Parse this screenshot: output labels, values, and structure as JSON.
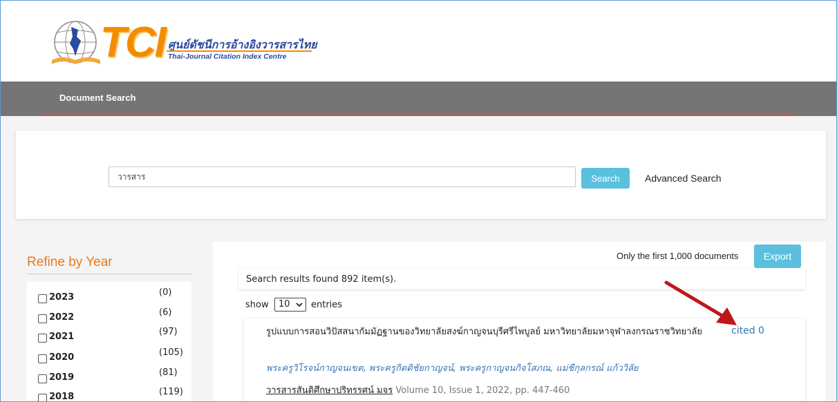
{
  "header": {
    "logo_tci": "TCI",
    "logo_thai": "ศูนย์ดัชนีการอ้างอิงวารสารไทย",
    "logo_eng": "Thai-Journal Citation Index Centre"
  },
  "nav": {
    "items": [
      {
        "label": "Document Search"
      }
    ]
  },
  "search": {
    "value": "วารสาร",
    "button_label": "Search",
    "advanced_label": "Advanced Search"
  },
  "refine": {
    "title": "Refine by Year",
    "years": [
      {
        "year": "2023",
        "count": "(0)"
      },
      {
        "year": "2022",
        "count": "(6)"
      },
      {
        "year": "2021",
        "count": "(97)"
      },
      {
        "year": "2020",
        "count": "(105)"
      },
      {
        "year": "2019",
        "count": "(81)"
      },
      {
        "year": "2018",
        "count": "(119)"
      }
    ]
  },
  "results": {
    "export_note": "Only the first 1,000 documents",
    "export_label": "Export",
    "found_text": "Search results found 892 item(s).",
    "show_label": "show",
    "entries_value": "10",
    "entries_label": "entries",
    "items": [
      {
        "title": "รูปแบบการสอนวิปัสสนากัมมัฏฐานของวิทยาลัยสงฆ์กาญจนบุรีศรีไพบูลย์ มหาวิทยาลัยมหาจุฬาลงกรณราชวิทยาลัย",
        "cited": "cited 0",
        "authors": "พระครูวิโรจน์กาญจนเขต, พระครูกิตติชัยกาญจน์, พระครูกาญจนกิจโสภณ, แม่ชีกุลกรณ์ แก้ววิลัย",
        "journal": "วารสารสันติศึกษาปริทรรศน์ มจร",
        "volume": "Volume 10, Issue 1, 2022, pp. 447-460"
      }
    ]
  },
  "colors": {
    "accent": "#5bc0de",
    "nav_bg": "#757575",
    "nav_line": "#e8412a",
    "refine_title": "#e57a1c",
    "link": "#3573b8",
    "arrow": "#c0161b"
  }
}
